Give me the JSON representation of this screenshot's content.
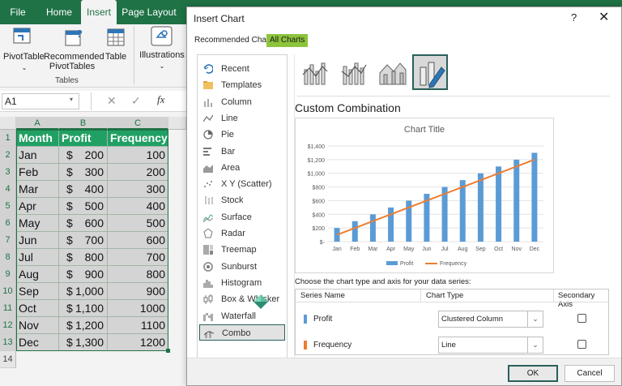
{
  "ribbon": {
    "tabs": [
      "File",
      "Home",
      "Insert",
      "Page Layout"
    ],
    "active_tab": "Insert",
    "buttons": {
      "pivot": "PivotTable",
      "recommended": "Recommended PivotTables",
      "table": "Table",
      "illustrations": "Illustrations"
    },
    "group_label": "Tables"
  },
  "formula_bar": {
    "name_box": "A1",
    "fx_label": "fx"
  },
  "sheet": {
    "col_headers": [
      "A",
      "B",
      "C"
    ],
    "row_numbers": [
      "1",
      "2",
      "3",
      "4",
      "5",
      "6",
      "7",
      "8",
      "9",
      "10",
      "11",
      "12",
      "13",
      "14"
    ],
    "header_row": [
      "Month",
      "Profit",
      "Frequency"
    ],
    "rows": [
      {
        "month": "Jan",
        "profit_sym": "$",
        "profit": "200",
        "freq": "100"
      },
      {
        "month": "Feb",
        "profit_sym": "$",
        "profit": "300",
        "freq": "200"
      },
      {
        "month": "Mar",
        "profit_sym": "$",
        "profit": "400",
        "freq": "300"
      },
      {
        "month": "Apr",
        "profit_sym": "$",
        "profit": "500",
        "freq": "400"
      },
      {
        "month": "May",
        "profit_sym": "$",
        "profit": "600",
        "freq": "500"
      },
      {
        "month": "Jun",
        "profit_sym": "$",
        "profit": "700",
        "freq": "600"
      },
      {
        "month": "Jul",
        "profit_sym": "$",
        "profit": "800",
        "freq": "700"
      },
      {
        "month": "Aug",
        "profit_sym": "$",
        "profit": "900",
        "freq": "800"
      },
      {
        "month": "Sep",
        "profit_sym": "$",
        "profit": "1,000",
        "freq": "900"
      },
      {
        "month": "Oct",
        "profit_sym": "$",
        "profit": "1,100",
        "freq": "1000"
      },
      {
        "month": "Nov",
        "profit_sym": "$",
        "profit": "1,200",
        "freq": "1100"
      },
      {
        "month": "Dec",
        "profit_sym": "$",
        "profit": "1,300",
        "freq": "1200"
      }
    ]
  },
  "dialog": {
    "title": "Insert Chart",
    "help": "?",
    "close": "✕",
    "tabs": [
      "Recommended Charts",
      "All Charts"
    ],
    "active_tab": "All Charts",
    "chart_types": [
      "Recent",
      "Templates",
      "Column",
      "Line",
      "Pie",
      "Bar",
      "Area",
      "X Y (Scatter)",
      "Stock",
      "Surface",
      "Radar",
      "Treemap",
      "Sunburst",
      "Histogram",
      "Box & Whisker",
      "Waterfall",
      "Combo"
    ],
    "selected_type": "Combo",
    "section_title": "Custom Combination",
    "choose_text": "Choose the chart type and axis for your data series:",
    "table_headers": {
      "series": "Series Name",
      "type": "Chart Type",
      "axis": "Secondary Axis"
    },
    "series": [
      {
        "name": "Profit",
        "chart_type": "Clustered Column",
        "secondary": false,
        "color": "#5b9bd5"
      },
      {
        "name": "Frequency",
        "chart_type": "Line",
        "secondary": false,
        "color": "#ed7d31"
      }
    ],
    "ok_label": "OK",
    "cancel_label": "Cancel"
  },
  "chart_data": {
    "type": "bar",
    "title": "Chart Title",
    "categories": [
      "Jan",
      "Feb",
      "Mar",
      "Apr",
      "May",
      "Jun",
      "Jul",
      "Aug",
      "Sep",
      "Oct",
      "Nov",
      "Dec"
    ],
    "series": [
      {
        "name": "Profit",
        "type": "bar",
        "color": "#5b9bd5",
        "values": [
          200,
          300,
          400,
          500,
          600,
          700,
          800,
          900,
          1000,
          1100,
          1200,
          1300
        ]
      },
      {
        "name": "Frequency",
        "type": "line",
        "color": "#ed7d31",
        "values": [
          100,
          200,
          300,
          400,
          500,
          600,
          700,
          800,
          900,
          1000,
          1100,
          1200
        ]
      }
    ],
    "y_ticks": [
      "$-",
      "$200",
      "$400",
      "$600",
      "$800",
      "$1,000",
      "$1,200",
      "$1,400"
    ],
    "ylim": [
      0,
      1400
    ],
    "legend": "bottom",
    "grid": true
  },
  "colors": {
    "excel_green": "#1f7246",
    "header_fill": "#21a064",
    "accent_teal": "#2a5f5a",
    "active_tab": "#8cc43c"
  }
}
